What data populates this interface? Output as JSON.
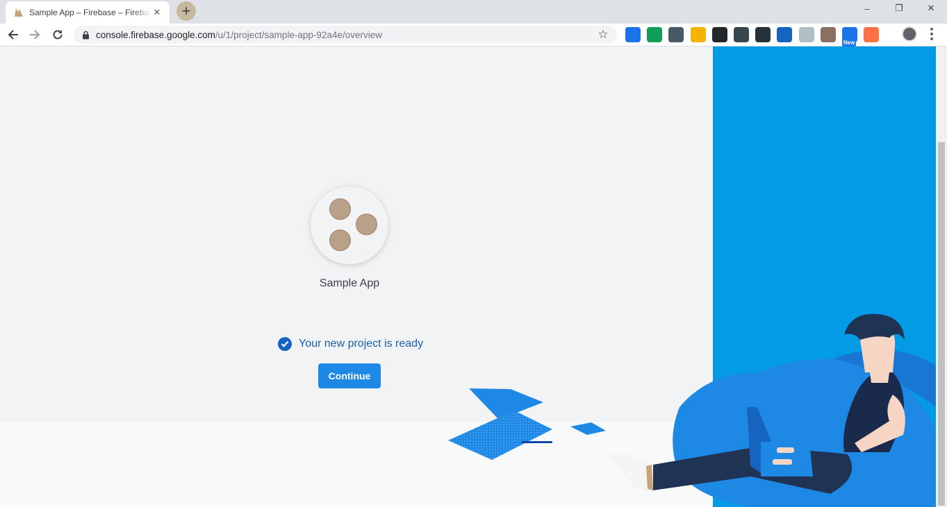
{
  "browser": {
    "tab": {
      "title": "Sample App – Firebase – Firebase console"
    },
    "new_tab_symbol": "+",
    "window_controls": [
      "–",
      "❐",
      "✕"
    ],
    "address_bar": {
      "host": "console.firebase.google.com",
      "path": "/u/1/project/sample-app-92a4e/overview"
    },
    "extensions": [
      {
        "name": "translate-extension-icon",
        "color": "#1a73e8"
      },
      {
        "name": "drive-extension-icon",
        "color": "#0f9d58"
      },
      {
        "name": "notes-extension-icon",
        "color": "#455a64"
      },
      {
        "name": "mail-extension-icon",
        "color": "#f4b400"
      },
      {
        "name": "discord-extension-icon",
        "color": "#23272a"
      },
      {
        "name": "paint-extension-icon",
        "color": "#37474f"
      },
      {
        "name": "download-extension-icon",
        "color": "#263238"
      },
      {
        "name": "pin-extension-icon",
        "color": "#1565c0"
      },
      {
        "name": "angular-extension-icon",
        "color": "#b0bec5"
      },
      {
        "name": "cat-extension-icon",
        "color": "#8d6e63"
      },
      {
        "name": "new-extension-icon",
        "color": "#1a73e8",
        "badge": "New"
      },
      {
        "name": "firefox-extension-icon",
        "color": "#ff7043"
      }
    ]
  },
  "page": {
    "project_name": "Sample App",
    "status_text": "Your new project is ready",
    "continue_label": "Continue"
  },
  "colors": {
    "accent": "#039be5",
    "button": "#1e88e5",
    "check": "#1565c0",
    "avatar_dots": "#b9a189"
  }
}
